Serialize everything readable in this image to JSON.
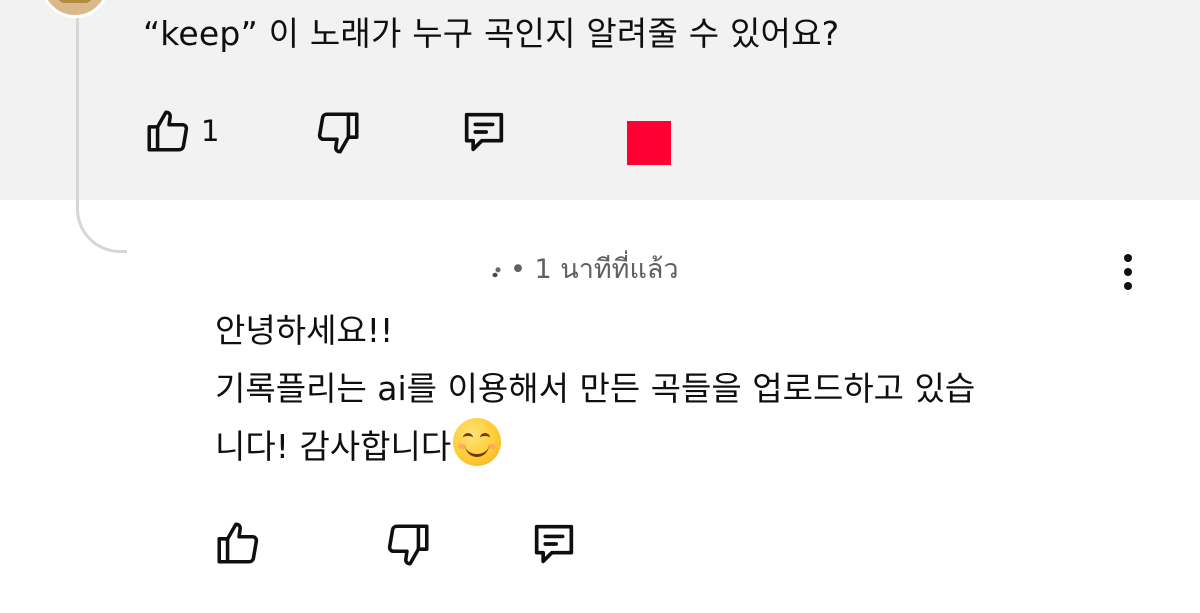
{
  "comment": {
    "text": "“keep” 이 노래가 누구 곡인지 알려줄 수 있어요?",
    "like_count": "1",
    "accent_color": "#ff0033"
  },
  "reply": {
    "meta": "• 1 นาทีที่แล้ว",
    "body_lines": [
      "안녕하세요!!",
      "기록플리는 ai를 이용해서 만든 곡들을 업로드하고 있습",
      "니다! 감사합니다"
    ],
    "emoji": "smiling-face"
  },
  "icons": {
    "like": "thumbs-up-icon",
    "dislike": "thumbs-down-icon",
    "reply": "comment-icon",
    "more": "more-vertical-icon"
  }
}
